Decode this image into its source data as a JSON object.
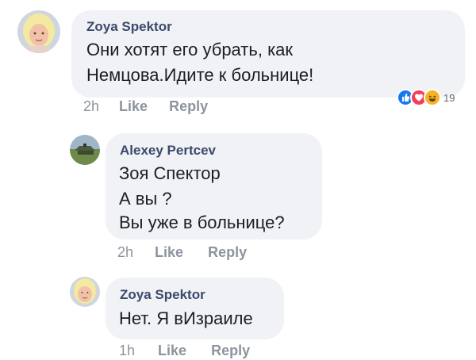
{
  "comments": [
    {
      "author": "Zoya Spektor",
      "lines": [
        "Они хотят его убрать, как",
        "Немцова.Идите к больнице!"
      ],
      "time": "2h",
      "like": "Like",
      "reply": "Reply",
      "reaction_count": "19",
      "reactions": [
        "like-icon",
        "love-icon",
        "haha-icon"
      ]
    },
    {
      "author": "Alexey Pertcev",
      "lines": [
        "Зоя Спектор",
        "А вы ?",
        "Вы уже в больнице?"
      ],
      "time": "2h",
      "like": "Like",
      "reply": "Reply"
    },
    {
      "author": "Zoya Spektor",
      "lines": [
        "Нет. Я вИзраиле"
      ],
      "time": "1h",
      "like": "Like",
      "reply": "Reply"
    }
  ],
  "colors": {
    "bubble": "#f0f2f5",
    "author": "#3b4a6b",
    "meta": "#8d949e",
    "like_reaction": "#1877f2",
    "love_reaction": "#f33e58",
    "haha_reaction": "#f7b125"
  }
}
